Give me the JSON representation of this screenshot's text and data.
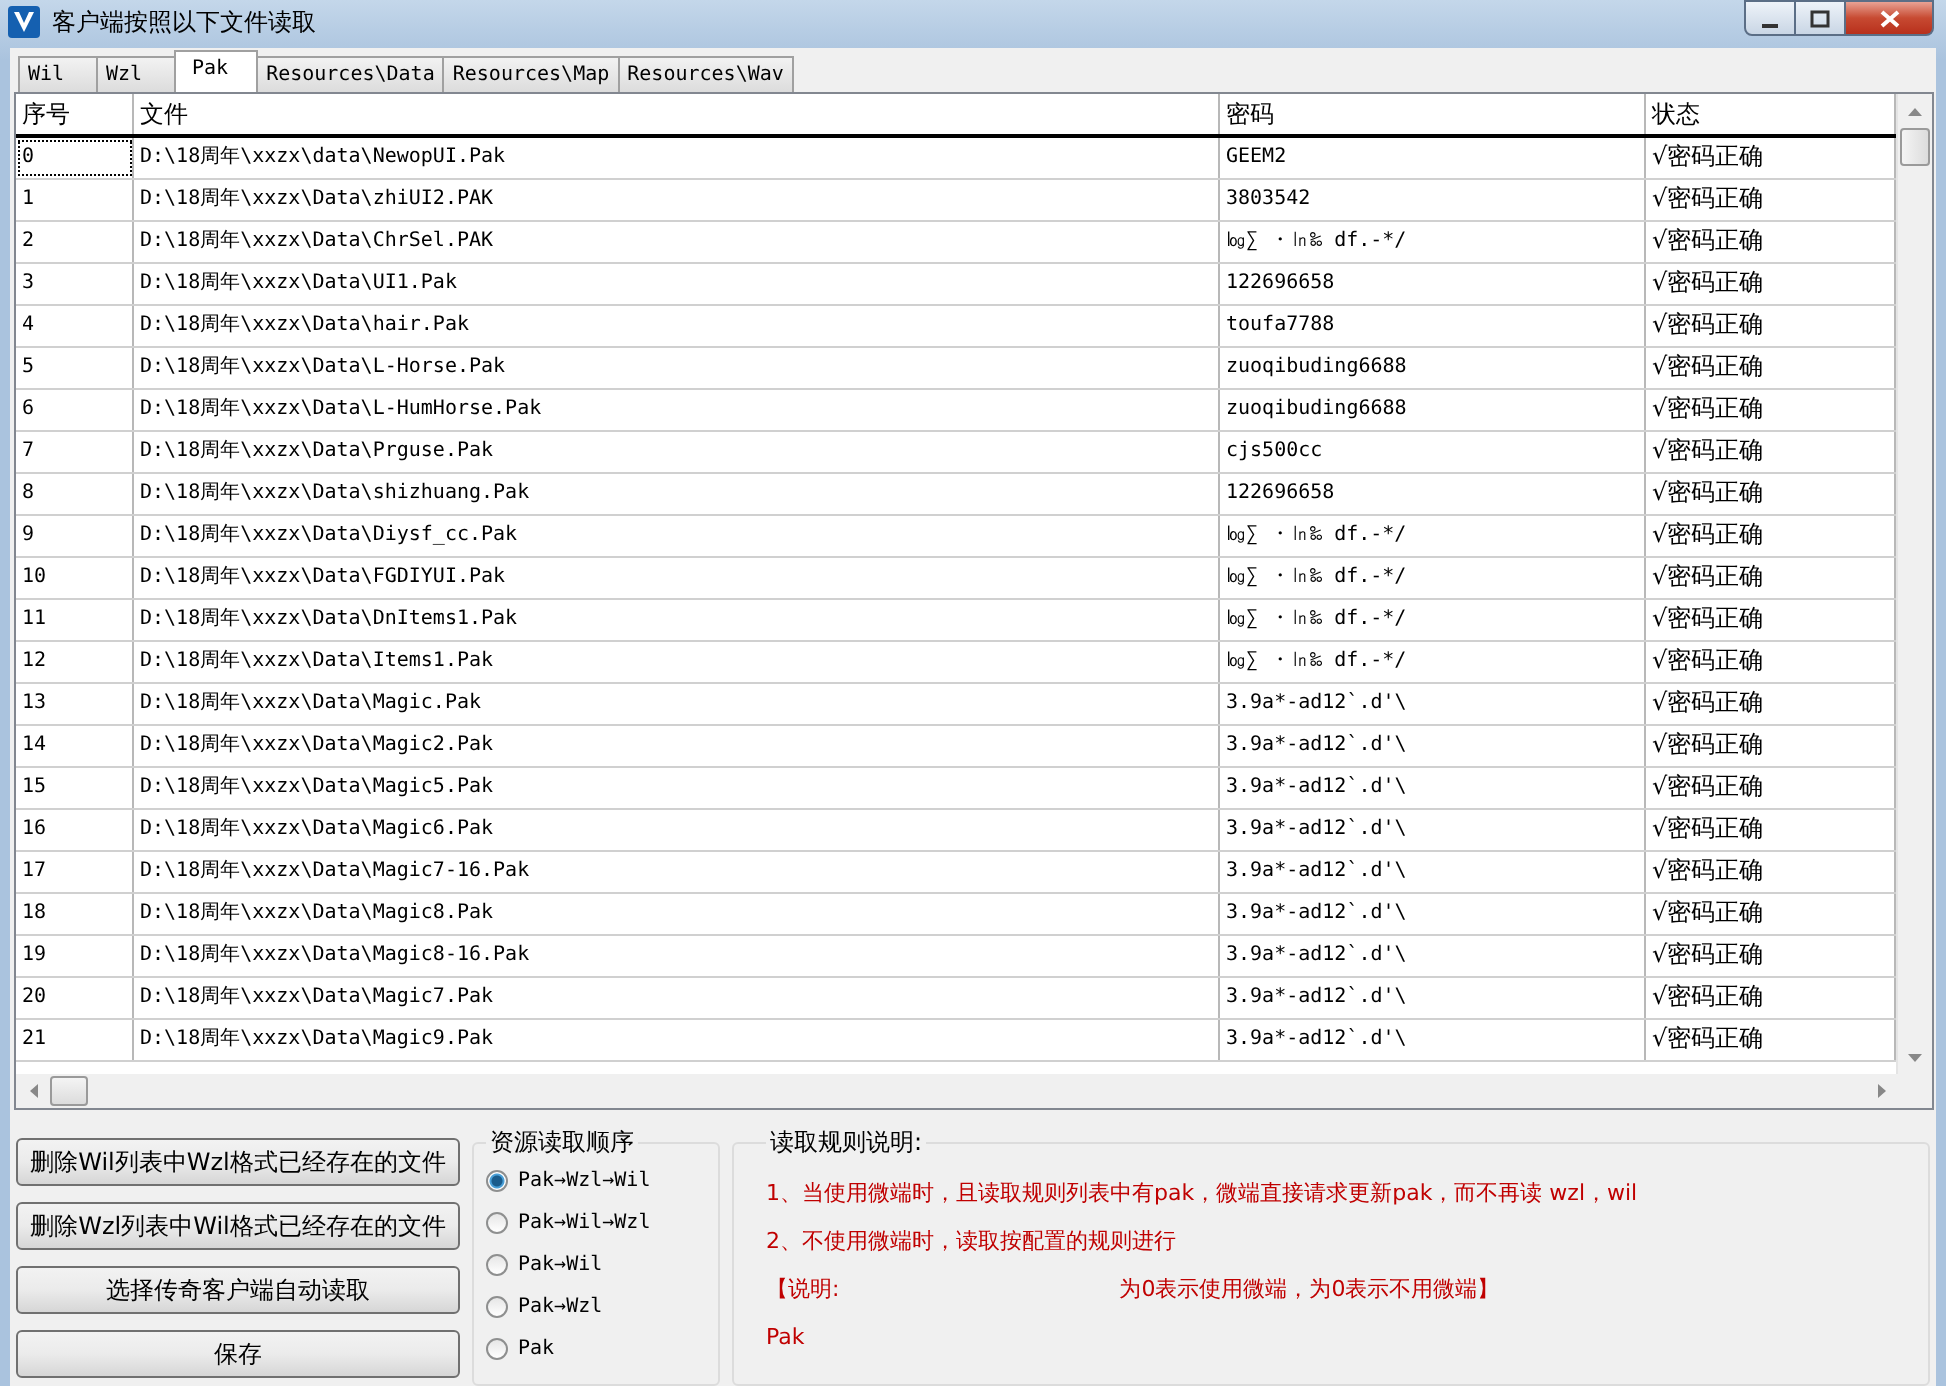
{
  "window": {
    "title": "客户端按照以下文件读取",
    "controls": [
      {
        "kind": "minimize"
      },
      {
        "kind": "maximize"
      },
      {
        "kind": "close"
      }
    ]
  },
  "tabs": [
    {
      "label": "Wil",
      "selected": false
    },
    {
      "label": "Wzl",
      "selected": false
    },
    {
      "label": "Pak",
      "selected": true
    },
    {
      "label": "Resources\\Data",
      "selected": false
    },
    {
      "label": "Resources\\Map",
      "selected": false
    },
    {
      "label": "Resources\\Wav",
      "selected": false
    }
  ],
  "table": {
    "columns": [
      "序号",
      "文件",
      "密码",
      "状态"
    ],
    "rows": [
      {
        "cells": [
          "0",
          "D:\\18周年\\xxzx\\data\\NewopUI.Pak",
          "GEEM2",
          "√密码正确"
        ],
        "focused": true
      },
      {
        "cells": [
          "1",
          "D:\\18周年\\xxzx\\Data\\zhiUI2.PAK",
          "3803542",
          "√密码正确"
        ],
        "focused": false
      },
      {
        "cells": [
          "2",
          "D:\\18周年\\xxzx\\Data\\ChrSel.PAK",
          "㏒∑ ・㏑‰ df.-*/",
          "√密码正确"
        ],
        "focused": false
      },
      {
        "cells": [
          "3",
          "D:\\18周年\\xxzx\\Data\\UI1.Pak",
          "122696658",
          "√密码正确"
        ],
        "focused": false
      },
      {
        "cells": [
          "4",
          "D:\\18周年\\xxzx\\Data\\hair.Pak",
          "toufa7788",
          "√密码正确"
        ],
        "focused": false
      },
      {
        "cells": [
          "5",
          "D:\\18周年\\xxzx\\Data\\L-Horse.Pak",
          "zuoqibuding6688",
          "√密码正确"
        ],
        "focused": false
      },
      {
        "cells": [
          "6",
          "D:\\18周年\\xxzx\\Data\\L-HumHorse.Pak",
          "zuoqibuding6688",
          "√密码正确"
        ],
        "focused": false
      },
      {
        "cells": [
          "7",
          "D:\\18周年\\xxzx\\Data\\Prguse.Pak",
          "cjs500cc",
          "√密码正确"
        ],
        "focused": false
      },
      {
        "cells": [
          "8",
          "D:\\18周年\\xxzx\\Data\\shizhuang.Pak",
          "122696658",
          "√密码正确"
        ],
        "focused": false
      },
      {
        "cells": [
          "9",
          "D:\\18周年\\xxzx\\Data\\Diysf_cc.Pak",
          "㏒∑ ・㏑‰ df.-*/",
          "√密码正确"
        ],
        "focused": false
      },
      {
        "cells": [
          "10",
          "D:\\18周年\\xxzx\\Data\\FGDIYUI.Pak",
          "㏒∑ ・㏑‰ df.-*/",
          "√密码正确"
        ],
        "focused": false
      },
      {
        "cells": [
          "11",
          "D:\\18周年\\xxzx\\Data\\DnItems1.Pak",
          "㏒∑ ・㏑‰ df.-*/",
          "√密码正确"
        ],
        "focused": false
      },
      {
        "cells": [
          "12",
          "D:\\18周年\\xxzx\\Data\\Items1.Pak",
          "㏒∑ ・㏑‰ df.-*/",
          "√密码正确"
        ],
        "focused": false
      },
      {
        "cells": [
          "13",
          "D:\\18周年\\xxzx\\Data\\Magic.Pak",
          "3.9a*-ad12`.d'\\",
          "√密码正确"
        ],
        "focused": false
      },
      {
        "cells": [
          "14",
          "D:\\18周年\\xxzx\\Data\\Magic2.Pak",
          "3.9a*-ad12`.d'\\",
          "√密码正确"
        ],
        "focused": false
      },
      {
        "cells": [
          "15",
          "D:\\18周年\\xxzx\\Data\\Magic5.Pak",
          "3.9a*-ad12`.d'\\",
          "√密码正确"
        ],
        "focused": false
      },
      {
        "cells": [
          "16",
          "D:\\18周年\\xxzx\\Data\\Magic6.Pak",
          "3.9a*-ad12`.d'\\",
          "√密码正确"
        ],
        "focused": false
      },
      {
        "cells": [
          "17",
          "D:\\18周年\\xxzx\\Data\\Magic7-16.Pak",
          "3.9a*-ad12`.d'\\",
          "√密码正确"
        ],
        "focused": false
      },
      {
        "cells": [
          "18",
          "D:\\18周年\\xxzx\\Data\\Magic8.Pak",
          "3.9a*-ad12`.d'\\",
          "√密码正确"
        ],
        "focused": false
      },
      {
        "cells": [
          "19",
          "D:\\18周年\\xxzx\\Data\\Magic8-16.Pak",
          "3.9a*-ad12`.d'\\",
          "√密码正确"
        ],
        "focused": false
      },
      {
        "cells": [
          "20",
          "D:\\18周年\\xxzx\\Data\\Magic7.Pak",
          "3.9a*-ad12`.d'\\",
          "√密码正确"
        ],
        "focused": false
      },
      {
        "cells": [
          "21",
          "D:\\18周年\\xxzx\\Data\\Magic9.Pak",
          "3.9a*-ad12`.d'\\",
          "√密码正确"
        ],
        "focused": false
      }
    ]
  },
  "buttons": [
    "删除Wil列表中Wzl格式已经存在的文件",
    "删除Wzl列表中Wil格式已经存在的文件",
    "选择传奇客户端自动读取",
    "保存"
  ],
  "read_order": {
    "title": "资源读取顺序",
    "options": [
      {
        "label": "Pak→Wzl→Wil",
        "selected": true
      },
      {
        "label": "Pak→Wil→Wzl",
        "selected": false
      },
      {
        "label": "Pak→Wil",
        "selected": false
      },
      {
        "label": "Pak→Wzl",
        "selected": false
      },
      {
        "label": "Pak",
        "selected": false
      }
    ]
  },
  "rules": {
    "title": "读取规则说明:",
    "lines": [
      [
        "1、当使用微端时，且读取规则列表中有pak，微端直接请求更新pak，而不再读 wzl，wil"
      ],
      [
        "2、不使用微端时，读取按配置的规则进行"
      ],
      [
        "【说明:",
        "为0表示使用微端，为0表示不用微端】"
      ],
      [
        "Pak"
      ]
    ]
  }
}
